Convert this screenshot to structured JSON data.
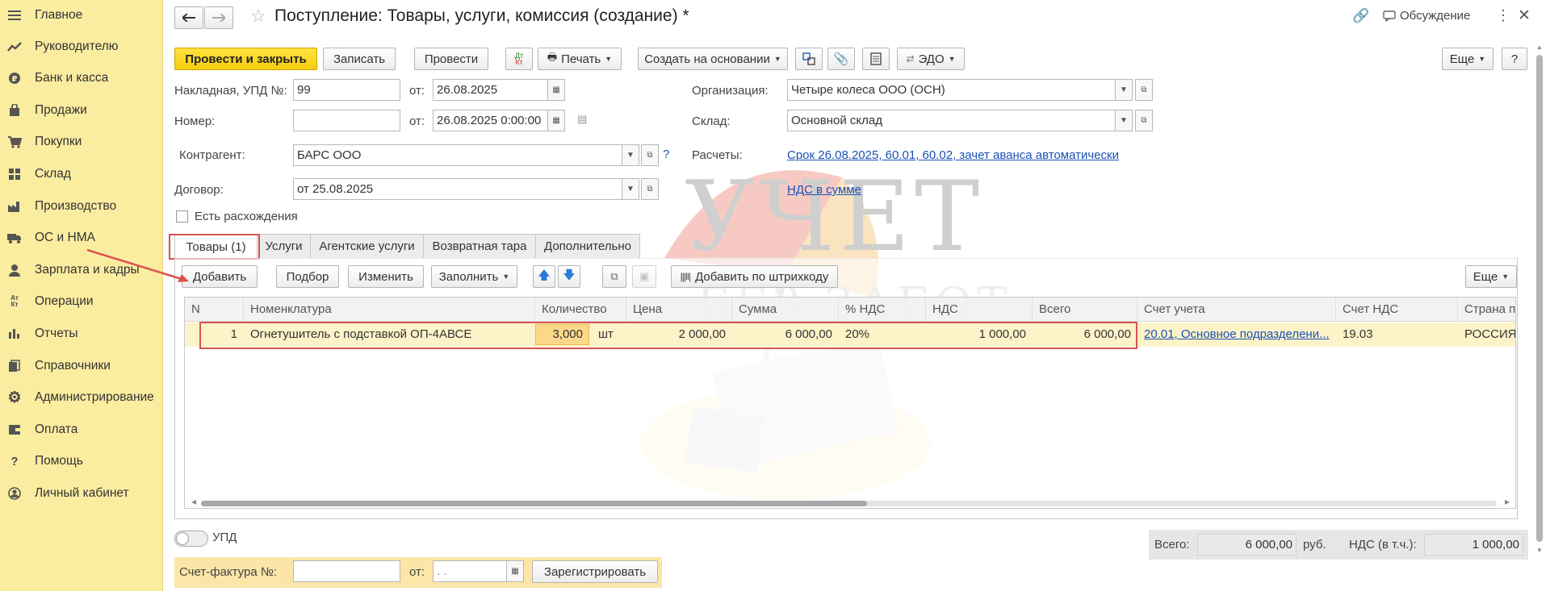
{
  "sidebar": {
    "items": [
      {
        "label": "Главное",
        "icon": "menu-icon"
      },
      {
        "label": "Руководителю",
        "icon": "trend-icon"
      },
      {
        "label": "Банк и касса",
        "icon": "coin-icon"
      },
      {
        "label": "Продажи",
        "icon": "bag-icon"
      },
      {
        "label": "Покупки",
        "icon": "cart-icon"
      },
      {
        "label": "Склад",
        "icon": "warehouse-icon"
      },
      {
        "label": "Производство",
        "icon": "factory-icon"
      },
      {
        "label": "ОС и НМА",
        "icon": "truck-icon"
      },
      {
        "label": "Зарплата и кадры",
        "icon": "person-icon"
      },
      {
        "label": "Операции",
        "icon": "dt-kt-icon"
      },
      {
        "label": "Отчеты",
        "icon": "bar-chart-icon"
      },
      {
        "label": "Справочники",
        "icon": "books-icon"
      },
      {
        "label": "Администрирование",
        "icon": "gear-icon"
      },
      {
        "label": "Оплата",
        "icon": "wallet-icon"
      },
      {
        "label": "Помощь",
        "icon": "question-icon"
      },
      {
        "label": "Личный кабинет",
        "icon": "account-icon"
      }
    ]
  },
  "header": {
    "title": "Поступление: Товары, услуги, комиссия (создание) *",
    "discussion_label": "Обсуждение"
  },
  "toolbar": {
    "post_close": "Провести и закрыть",
    "save": "Записать",
    "post": "Провести",
    "dtkt_top": "Дт",
    "dtkt_bottom": "Кт",
    "print": "Печать",
    "create_based": "Создать на основании",
    "edo": "ЭДО",
    "more": "Еще",
    "help": "?"
  },
  "form": {
    "invoice_label": "Накладная, УПД №:",
    "invoice_value": "99",
    "from_label": "от:",
    "invoice_date": "26.08.2025",
    "number_label": "Номер:",
    "number_value": "",
    "number_date": "26.08.2025  0:00:00",
    "org_label": "Организация:",
    "org_value": "Четыре колеса ООО (ОСН)",
    "warehouse_label": "Склад:",
    "warehouse_value": "Основной склад",
    "counterparty_label": "Контрагент:",
    "counterparty_value": "БАРС ООО",
    "settlements_label": "Расчеты:",
    "settlements_link": "Срок 26.08.2025, 60.01, 60.02, зачет аванса автоматически",
    "contract_label": "Договор:",
    "contract_value": "от 25.08.2025",
    "vat_link": "НДС в сумме",
    "discrepancy_label": "Есть расхождения"
  },
  "tabs": [
    {
      "label": "Товары (1)"
    },
    {
      "label": "Услуги"
    },
    {
      "label": "Агентские услуги"
    },
    {
      "label": "Возвратная тара"
    },
    {
      "label": "Дополнительно"
    }
  ],
  "table_toolbar": {
    "add": "Добавить",
    "pick": "Подбор",
    "edit": "Изменить",
    "fill": "Заполнить",
    "barcode": "Добавить по штрихкоду",
    "more": "Еще"
  },
  "table": {
    "columns": [
      "N",
      "Номенклатура",
      "Количество",
      "Цена",
      "Сумма",
      "% НДС",
      "НДС",
      "Всего",
      "Счет учета",
      "Счет НДС",
      "Страна пр"
    ],
    "rows": [
      {
        "n": "1",
        "item": "Огнетушитель с подставкой ОП-4АВСЕ",
        "qty": "3,000",
        "unit": "шт",
        "price": "2 000,00",
        "sum": "6 000,00",
        "vat_rate": "20%",
        "vat": "1 000,00",
        "total": "6 000,00",
        "account": "20.01, Основное подразделени...",
        "vat_account": "19.03",
        "country": "РОССИЯ"
      }
    ]
  },
  "footer": {
    "upd_label": "УПД",
    "invoice_label": "Счет-фактура №:",
    "invoice_value": "",
    "from_label": "от:",
    "invoice_date": " .  .",
    "register": "Зарегистрировать",
    "total_label": "Всего:",
    "total_value": "6 000,00",
    "currency": "руб.",
    "vat_label": "НДС (в т.ч.):",
    "vat_value": "1 000,00"
  },
  "watermark": {
    "line1": "УЧЕТ",
    "line2": "БЕЗ ЗАБОТ"
  },
  "colors": {
    "accent_yellow": "#f7cd0f",
    "sidebar_bg": "#fbeda0",
    "row_highlight": "#fdf2c4",
    "link": "#1a50b8",
    "annotation_red": "#d9534f"
  }
}
